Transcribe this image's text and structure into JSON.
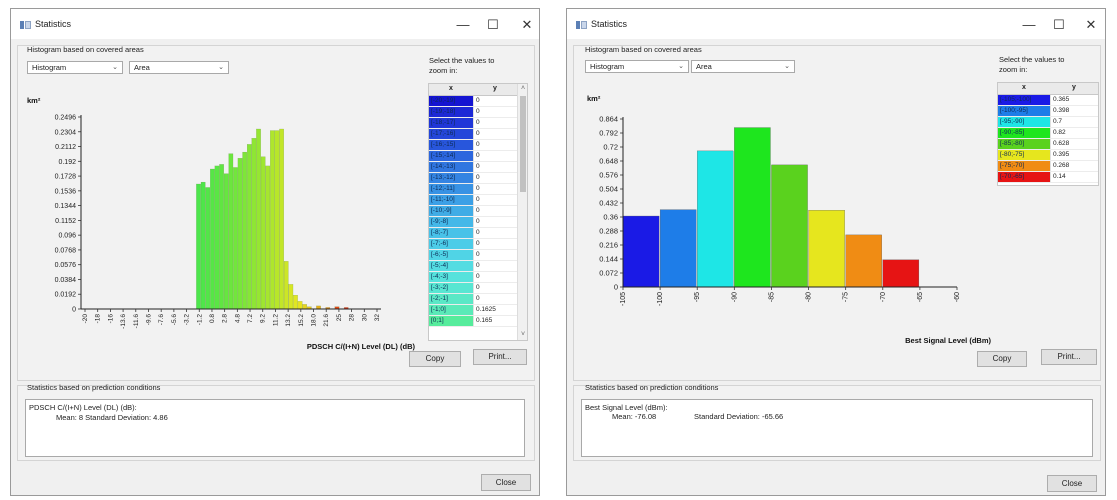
{
  "left_window": {
    "title": "Statistics",
    "controls": {
      "minimize": "—",
      "maximize": "☐",
      "close": "✕"
    },
    "histogram_group_label": "Histogram based on covered areas",
    "type_dropdown": "Histogram",
    "measure_dropdown": "Area",
    "select_label_line1": "Select the values to",
    "select_label_line2": "zoom in:",
    "table_headers": {
      "x": "x",
      "y": "y"
    },
    "table_rows": [
      {
        "x": "[-20;-19]",
        "y": "0",
        "color": "#1414d2"
      },
      {
        "x": "[-19;-18]",
        "y": "0",
        "color": "#1c28d6"
      },
      {
        "x": "[-18;-17]",
        "y": "0",
        "color": "#2036d8"
      },
      {
        "x": "[-17;-16]",
        "y": "0",
        "color": "#2446da"
      },
      {
        "x": "[-16;-15]",
        "y": "0",
        "color": "#2856dc"
      },
      {
        "x": "[-15;-14]",
        "y": "0",
        "color": "#2c66de"
      },
      {
        "x": "[-14;-13]",
        "y": "0",
        "color": "#3076e0"
      },
      {
        "x": "[-13;-12]",
        "y": "0",
        "color": "#3484e2"
      },
      {
        "x": "[-12;-11]",
        "y": "0",
        "color": "#3892e4"
      },
      {
        "x": "[-11;-10]",
        "y": "0",
        "color": "#3ca0e6"
      },
      {
        "x": "[-10;-9]",
        "y": "0",
        "color": "#40ace6"
      },
      {
        "x": "[-9;-8]",
        "y": "0",
        "color": "#44b8e8"
      },
      {
        "x": "[-8;-7]",
        "y": "0",
        "color": "#48c2e8"
      },
      {
        "x": "[-7;-6]",
        "y": "0",
        "color": "#4ccce8"
      },
      {
        "x": "[-6;-5]",
        "y": "0",
        "color": "#50d4e6"
      },
      {
        "x": "[-5;-4]",
        "y": "0",
        "color": "#54dce2"
      },
      {
        "x": "[-4;-3]",
        "y": "0",
        "color": "#56e2dc"
      },
      {
        "x": "[-3;-2]",
        "y": "0",
        "color": "#58e6d2"
      },
      {
        "x": "[-2;-1]",
        "y": "0",
        "color": "#5ae8c6"
      },
      {
        "x": "[-1;0]",
        "y": "0.1625",
        "color": "#5aeab8"
      },
      {
        "x": "[0;1]",
        "y": "0.165",
        "color": "#56ec9c"
      }
    ],
    "copy_button": "Copy",
    "print_button": "Print...",
    "prediction_group_label": "Statistics based on prediction conditions",
    "stats_line1": "PDSCH C/(I+N) Level (DL) (dB):",
    "stats_line2": "Mean: 8  Standard Deviation: 4.86",
    "close_button": "Close"
  },
  "right_window": {
    "title": "Statistics",
    "controls": {
      "minimize": "—",
      "maximize": "☐",
      "close": "✕"
    },
    "histogram_group_label": "Histogram based on covered areas",
    "type_dropdown": "Histogram",
    "measure_dropdown": "Area",
    "select_label_line1": "Select the values to",
    "select_label_line2": "zoom in:",
    "table_headers": {
      "x": "x",
      "y": "y"
    },
    "table_rows": [
      {
        "x": "[-105;-100]",
        "y": "0.365",
        "color": "#1a1ae6"
      },
      {
        "x": "[-100;-95]",
        "y": "0.398",
        "color": "#1e7de8"
      },
      {
        "x": "[-95;-90]",
        "y": "0.7",
        "color": "#1ee6e6"
      },
      {
        "x": "[-90;-85]",
        "y": "0.82",
        "color": "#1ee61e"
      },
      {
        "x": "[-85;-80]",
        "y": "0.628",
        "color": "#5ad21e"
      },
      {
        "x": "[-80;-75]",
        "y": "0.395",
        "color": "#e6e61e"
      },
      {
        "x": "[-75;-70]",
        "y": "0.268",
        "color": "#f08c14"
      },
      {
        "x": "[-70;-65]",
        "y": "0.14",
        "color": "#e61414"
      }
    ],
    "copy_button": "Copy",
    "print_button": "Print...",
    "prediction_group_label": "Statistics based on prediction conditions",
    "stats_line1": "Best Signal Level (dBm):",
    "stats_line2_mean": "Mean: -76.08",
    "stats_line2_sd": "Standard Deviation: -65.66",
    "close_button": "Close"
  },
  "chart_data": [
    {
      "type": "bar",
      "title": "",
      "xlabel": "PDSCH C/(I+N) Level (DL) (dB)",
      "ylabel": "km²",
      "ylim": [
        0,
        0.2496
      ],
      "y_ticks": [
        "0",
        "0.0192",
        "0.0384",
        "0.0576",
        "0.0768",
        "0.096",
        "0.1152",
        "0.1344",
        "0.1536",
        "0.1728",
        "0.192",
        "0.2112",
        "0.2304",
        "0.2496"
      ],
      "x_ticks": [
        "-20",
        "-18",
        "-16",
        "-13.6",
        "-11.6",
        "-9.6",
        "-7.6",
        "-5.6",
        "-3.2",
        "-1.2",
        "0.8",
        "2.8",
        "4.8",
        "7.2",
        "9.2",
        "11.2",
        "13.2",
        "15.2",
        "18.0",
        "21.6",
        "25",
        "28",
        "30",
        "32"
      ],
      "bars": [
        {
          "x": 0.0,
          "y": 0.1625,
          "color": "#4ce64c"
        },
        {
          "x": 0.8,
          "y": 0.165,
          "color": "#4ee64a"
        },
        {
          "x": 1.6,
          "y": 0.158,
          "color": "#52e648"
        },
        {
          "x": 2.4,
          "y": 0.182,
          "color": "#56e646"
        },
        {
          "x": 3.2,
          "y": 0.186,
          "color": "#5ae644"
        },
        {
          "x": 4.0,
          "y": 0.188,
          "color": "#60e642"
        },
        {
          "x": 4.8,
          "y": 0.176,
          "color": "#66e640"
        },
        {
          "x": 5.6,
          "y": 0.202,
          "color": "#6ce63e"
        },
        {
          "x": 6.4,
          "y": 0.184,
          "color": "#72e63c"
        },
        {
          "x": 7.2,
          "y": 0.196,
          "color": "#78e63a"
        },
        {
          "x": 8.0,
          "y": 0.204,
          "color": "#7ee638"
        },
        {
          "x": 8.8,
          "y": 0.214,
          "color": "#86e636"
        },
        {
          "x": 9.6,
          "y": 0.222,
          "color": "#8ee634"
        },
        {
          "x": 10.4,
          "y": 0.234,
          "color": "#96e632"
        },
        {
          "x": 11.2,
          "y": 0.198,
          "color": "#9ee630"
        },
        {
          "x": 12.0,
          "y": 0.186,
          "color": "#a6e62e"
        },
        {
          "x": 12.8,
          "y": 0.232,
          "color": "#aee62c"
        },
        {
          "x": 13.6,
          "y": 0.232,
          "color": "#b8e62a"
        },
        {
          "x": 14.4,
          "y": 0.234,
          "color": "#c2e628"
        },
        {
          "x": 15.2,
          "y": 0.062,
          "color": "#cce626"
        },
        {
          "x": 16.0,
          "y": 0.032,
          "color": "#d6e624"
        },
        {
          "x": 16.8,
          "y": 0.018,
          "color": "#e0e622"
        },
        {
          "x": 17.6,
          "y": 0.01,
          "color": "#e6e220"
        },
        {
          "x": 18.4,
          "y": 0.006,
          "color": "#e6d41e"
        },
        {
          "x": 19.2,
          "y": 0.003,
          "color": "#e6c81c"
        },
        {
          "x": 20.8,
          "y": 0.004,
          "color": "#e6b01a"
        },
        {
          "x": 22.4,
          "y": 0.002,
          "color": "#e68c18"
        },
        {
          "x": 24.0,
          "y": 0.003,
          "color": "#e64a16"
        },
        {
          "x": 25.6,
          "y": 0.002,
          "color": "#e62a14"
        }
      ]
    },
    {
      "type": "bar",
      "title": "",
      "xlabel": "Best Signal Level (dBm)",
      "ylabel": "km²",
      "ylim": [
        0,
        0.864
      ],
      "y_ticks": [
        "0",
        "0.072",
        "0.144",
        "0.216",
        "0.288",
        "0.36",
        "0.432",
        "0.504",
        "0.576",
        "0.648",
        "0.72",
        "0.792",
        "0.864"
      ],
      "x_ticks": [
        "-105",
        "-100",
        "-95",
        "-90",
        "-85",
        "-80",
        "-75",
        "-70",
        "-65",
        "-60"
      ],
      "categories": [
        "[-105;-100]",
        "[-100;-95]",
        "[-95;-90]",
        "[-90;-85]",
        "[-85;-80]",
        "[-80;-75]",
        "[-75;-70]",
        "[-70;-65]"
      ],
      "values": [
        0.365,
        0.398,
        0.7,
        0.82,
        0.628,
        0.395,
        0.268,
        0.14
      ],
      "colors": [
        "#1a1ae6",
        "#1e7de8",
        "#1ee6e6",
        "#1ee61e",
        "#5ad21e",
        "#e6e61e",
        "#f08c14",
        "#e61414"
      ]
    }
  ]
}
